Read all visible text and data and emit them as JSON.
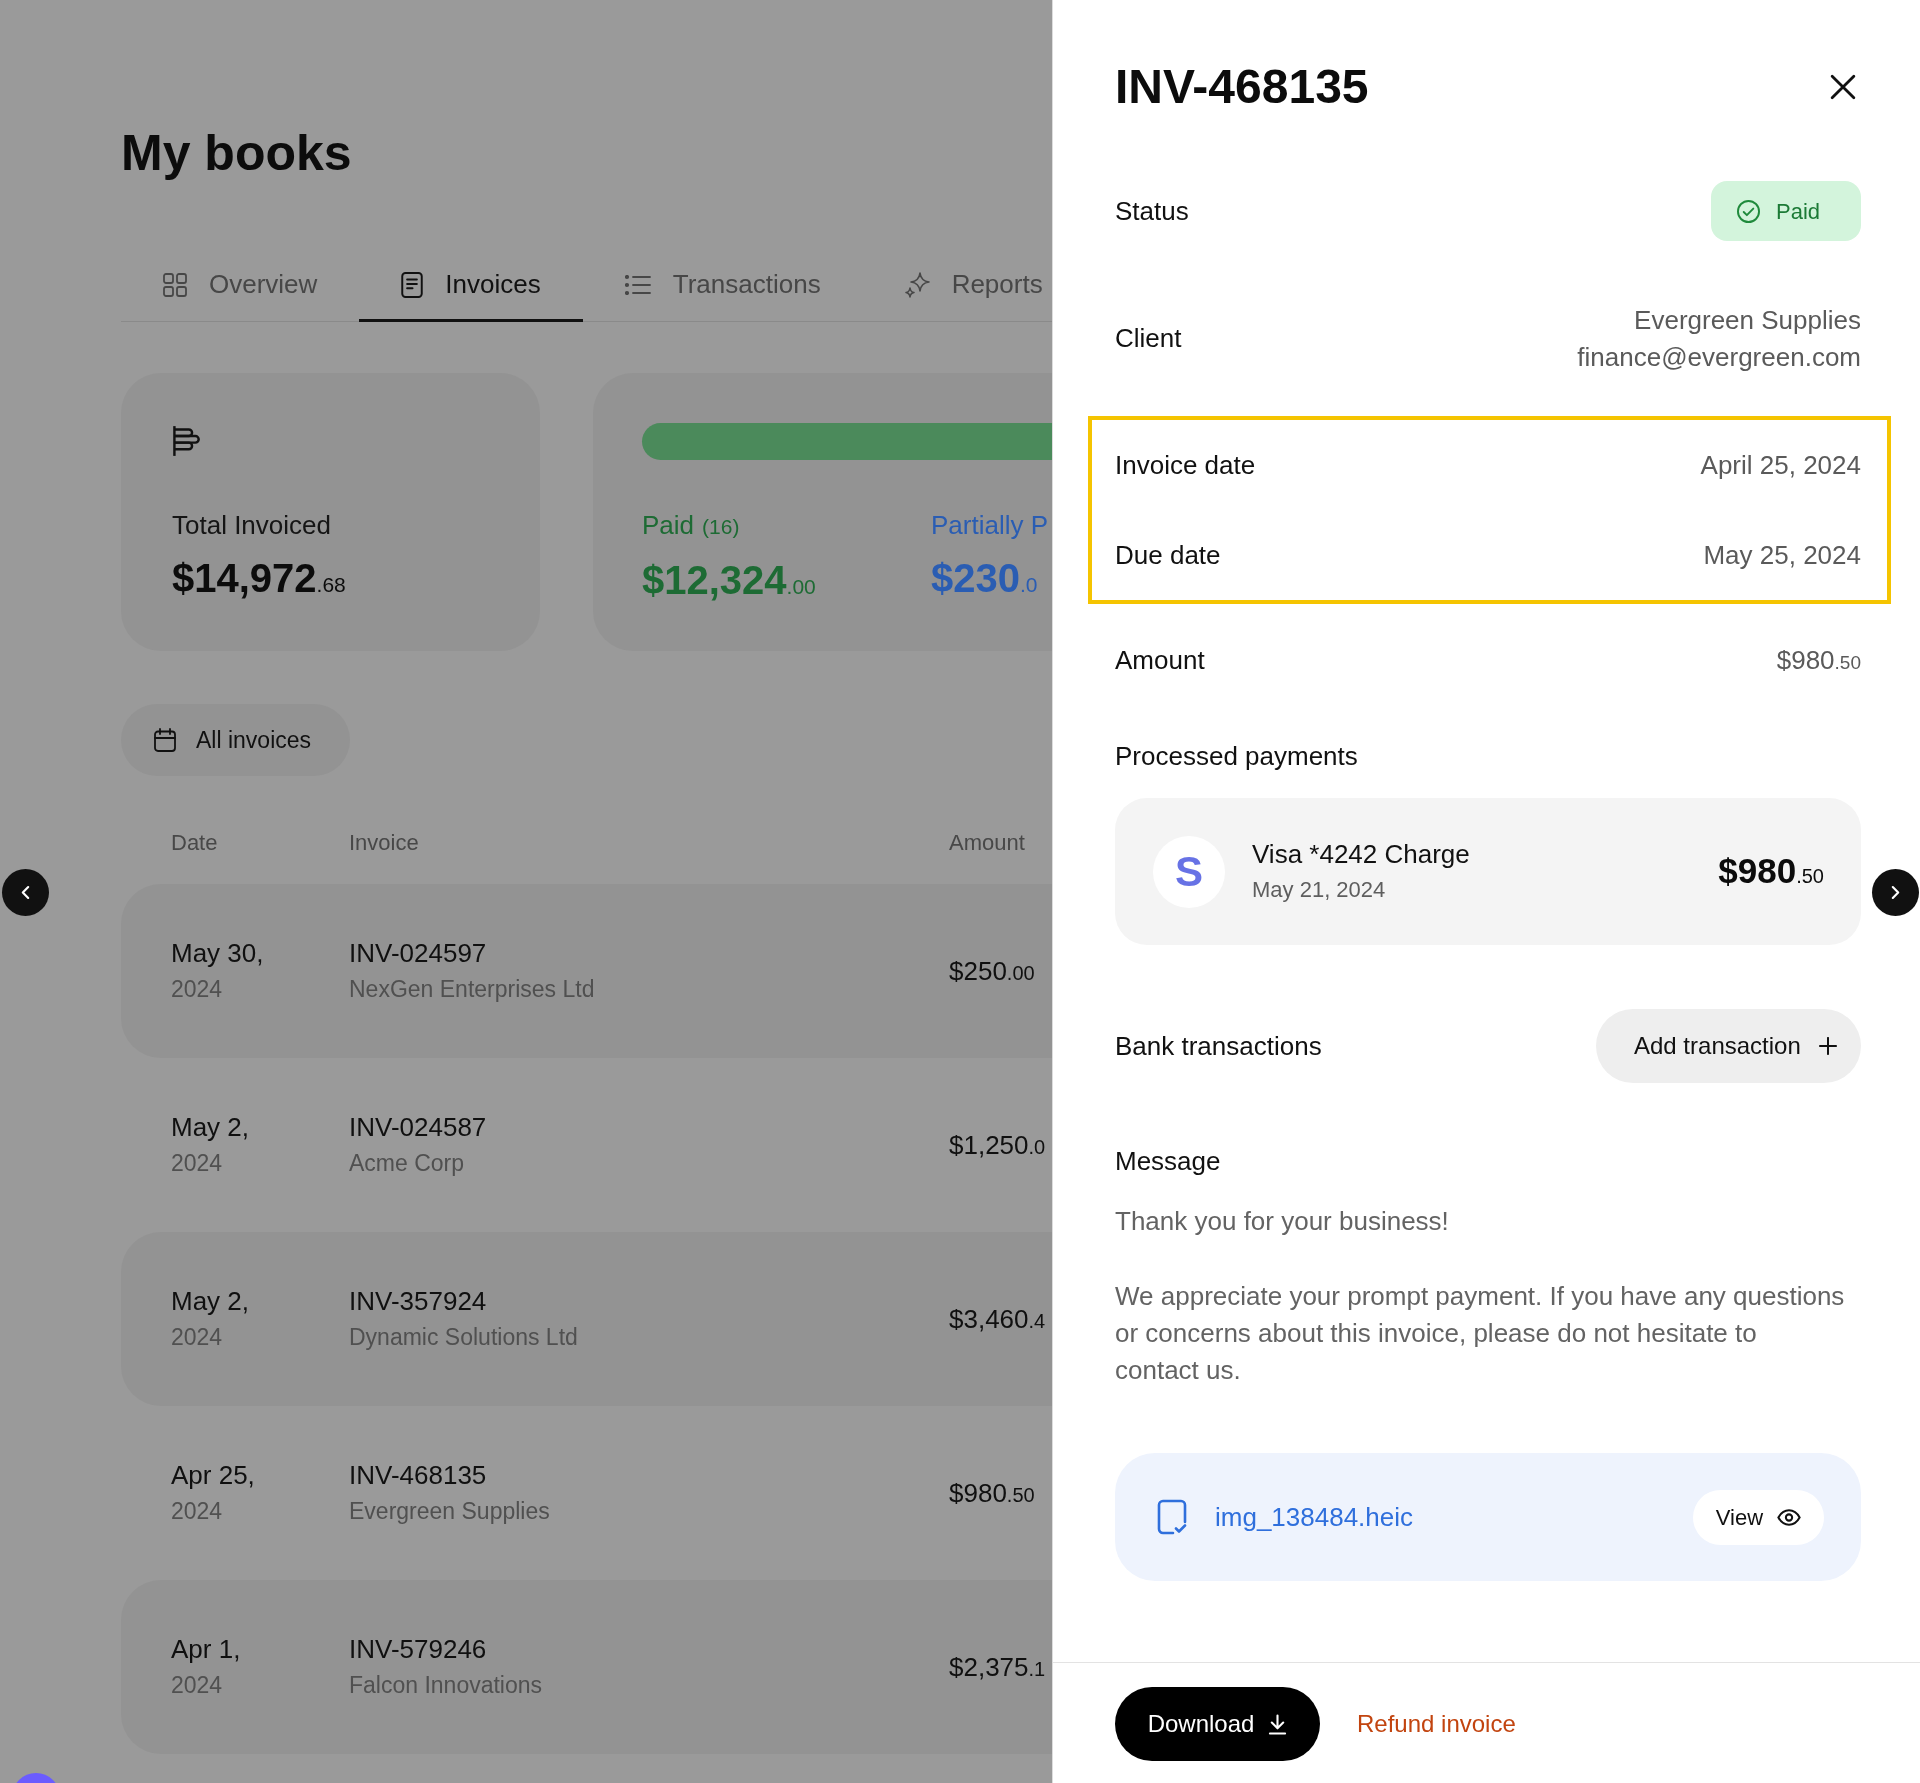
{
  "page": {
    "title": "My books"
  },
  "tabs": [
    {
      "label": "Overview",
      "selected": false
    },
    {
      "label": "Invoices",
      "selected": true
    },
    {
      "label": "Transactions",
      "selected": false
    },
    {
      "label": "Reports",
      "selected": false
    }
  ],
  "summary": {
    "total": {
      "label": "Total Invoiced",
      "main": "$14,972",
      "cents": ".68"
    },
    "breakdown": [
      {
        "label": "Paid",
        "count": "(16)",
        "main": "$12,324",
        "cents": ".00",
        "color": "#1d6b34"
      },
      {
        "label": "Partially P",
        "main": "$230",
        "cents": ".0",
        "color": "#2a5db3"
      }
    ]
  },
  "filter": {
    "label": "All invoices"
  },
  "table": {
    "columns": [
      "Date",
      "Invoice",
      "Amount"
    ],
    "rows": [
      {
        "date": "May 30,",
        "year": "2024",
        "invoice": "INV-024597",
        "client": "NexGen Enterprises Ltd",
        "main": "$250",
        "cents": ".00"
      },
      {
        "date": "May 2,",
        "year": "2024",
        "invoice": "INV-024587",
        "client": "Acme Corp",
        "main": "$1,250",
        "cents": ".0"
      },
      {
        "date": "May 2,",
        "year": "2024",
        "invoice": "INV-357924",
        "client": "Dynamic Solutions Ltd",
        "main": "$3,460",
        "cents": ".4"
      },
      {
        "date": "Apr 25,",
        "year": "2024",
        "invoice": "INV-468135",
        "client": "Evergreen Supplies",
        "main": "$980",
        "cents": ".50"
      },
      {
        "date": "Apr 1,",
        "year": "2024",
        "invoice": "INV-579246",
        "client": "Falcon Innovations",
        "main": "$2,375",
        "cents": ".1"
      }
    ]
  },
  "panel": {
    "title": "INV-468135",
    "details": [
      {
        "kind": "status",
        "label": "Status",
        "value": "Paid",
        "highlighted": false
      },
      {
        "kind": "lines",
        "label": "Client",
        "lines": [
          "Evergreen Supplies",
          "finance@evergreen.com"
        ],
        "highlighted": false
      },
      {
        "kind": "text",
        "label": "Invoice date",
        "value": "April 25, 2024",
        "highlighted": true
      },
      {
        "kind": "text",
        "label": "Due date",
        "value": "May 25, 2024",
        "highlighted": true
      },
      {
        "kind": "amount",
        "label": "Amount",
        "main": "$980",
        "cents": ".50",
        "highlighted": false
      }
    ],
    "payments": {
      "heading": "Processed payments",
      "items": [
        {
          "logo": "S",
          "title": "Visa *4242 Charge",
          "date": "May 21, 2024",
          "main": "$980",
          "cents": ".50"
        }
      ]
    },
    "bank": {
      "label": "Bank transactions",
      "button": "Add transaction"
    },
    "message": {
      "heading": "Message",
      "paragraphs": [
        "Thank you for your business!",
        "We appreciate your prompt payment. If you have any questions or concerns about this invoice, please do not hesitate to contact us."
      ]
    },
    "attachment": {
      "filename": "img_138484.heic",
      "button": "View"
    },
    "footer": {
      "download": "Download",
      "refund": "Refund invoice"
    }
  }
}
